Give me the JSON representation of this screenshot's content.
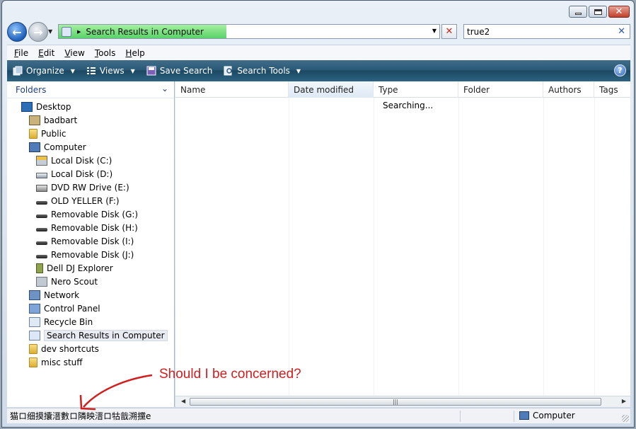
{
  "window": {
    "caption_buttons": [
      "minimize",
      "maximize",
      "close"
    ]
  },
  "address": {
    "text": "Search Results in Computer",
    "progress": 0.44
  },
  "search": {
    "value": "true2"
  },
  "menu": [
    {
      "label": "File"
    },
    {
      "label": "Edit"
    },
    {
      "label": "View"
    },
    {
      "label": "Tools"
    },
    {
      "label": "Help"
    }
  ],
  "toolbar": {
    "organize": "Organize",
    "views": "Views",
    "save_search": "Save Search",
    "search_tools": "Search Tools"
  },
  "folders": {
    "header": "Folders",
    "items": [
      {
        "label": "Desktop",
        "icon": "desktop-icon"
      },
      {
        "label": "badbart",
        "icon": "user-folder-icon"
      },
      {
        "label": "Public",
        "icon": "folder-icon"
      },
      {
        "label": "Computer",
        "icon": "computer-icon"
      },
      {
        "label": "Local Disk (C:)",
        "icon": "system-disk-icon"
      },
      {
        "label": "Local Disk (D:)",
        "icon": "hard-disk-icon"
      },
      {
        "label": "DVD RW Drive (E:)",
        "icon": "dvd-drive-icon"
      },
      {
        "label": "OLD YELLER (F:)",
        "icon": "removable-drive-icon"
      },
      {
        "label": "Removable Disk (G:)",
        "icon": "removable-drive-icon"
      },
      {
        "label": "Removable Disk (H:)",
        "icon": "removable-drive-icon"
      },
      {
        "label": "Removable Disk (I:)",
        "icon": "removable-drive-icon"
      },
      {
        "label": "Removable Disk (J:)",
        "icon": "removable-drive-icon"
      },
      {
        "label": "Dell DJ Explorer",
        "icon": "media-player-icon"
      },
      {
        "label": "Nero Scout",
        "icon": "nero-scout-icon"
      },
      {
        "label": "Network",
        "icon": "network-icon"
      },
      {
        "label": "Control Panel",
        "icon": "control-panel-icon"
      },
      {
        "label": "Recycle Bin",
        "icon": "recycle-bin-icon"
      },
      {
        "label": "Search Results in Computer",
        "icon": "search-folder-icon"
      },
      {
        "label": "dev shortcuts",
        "icon": "folder-icon"
      },
      {
        "label": "misc stuff",
        "icon": "folder-icon"
      }
    ]
  },
  "columns": [
    "Name",
    "Date modified",
    "Type",
    "Folder",
    "Authors",
    "Tags"
  ],
  "searching_text": "Searching...",
  "status": {
    "left_text": "猫ロ细摸攮溍數ロ隣映溍ロ牯戠溯攩e",
    "right_text": "Computer"
  },
  "annotation": {
    "text": "Should I be concerned?",
    "color": "#d11e1e"
  }
}
